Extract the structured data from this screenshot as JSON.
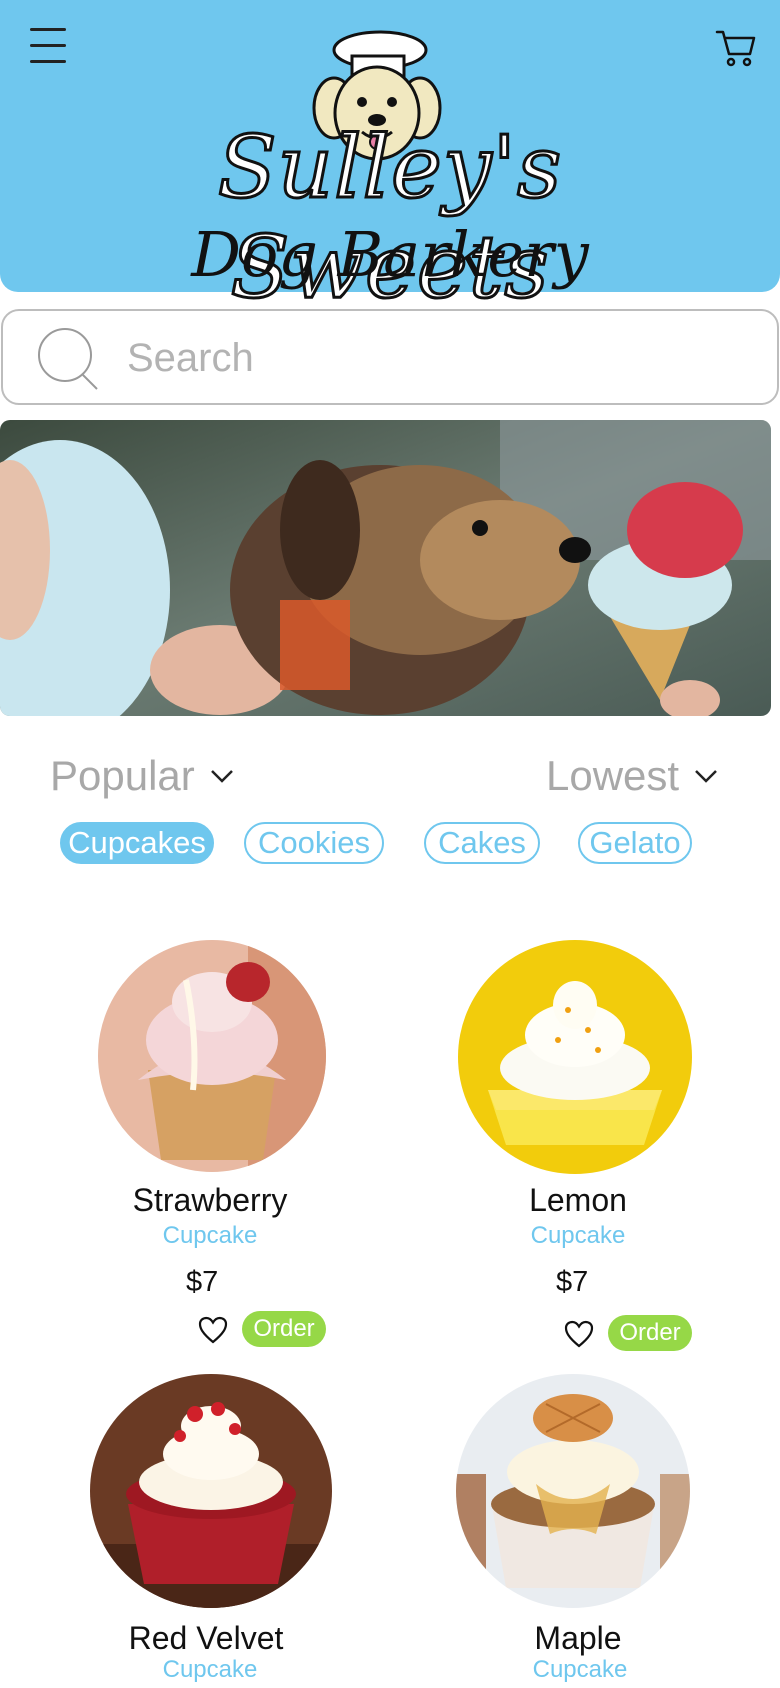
{
  "header": {
    "menu_icon": "hamburger-menu-icon",
    "cart_icon": "shopping-cart-icon",
    "logo_title": "Sulley's Sweets",
    "logo_subtitle": "Dog Barkery",
    "background_color": "#6fc7ee"
  },
  "search": {
    "placeholder": "Search",
    "icon": "search-icon"
  },
  "hero": {
    "description": "dog-licking-ice-cream-photo"
  },
  "filters": {
    "sort": "Popular",
    "price_order": "Lowest",
    "chevron_icon": "chevron-down-icon"
  },
  "categories": [
    {
      "label": "Cupcakes",
      "active": true
    },
    {
      "label": "Cookies",
      "active": false
    },
    {
      "label": "Cakes",
      "active": false
    },
    {
      "label": "Gelato",
      "active": false
    }
  ],
  "products": [
    {
      "name": "Strawberry",
      "type": "Cupcake",
      "price": "$7",
      "order_label": "Order"
    },
    {
      "name": "Lemon",
      "type": "Cupcake",
      "price": "$7",
      "order_label": "Order"
    },
    {
      "name": "Red Velvet",
      "type": "Cupcake"
    },
    {
      "name": "Maple",
      "type": "Cupcake"
    }
  ],
  "colors": {
    "accent": "#6fc7ee",
    "order_button": "#96d847",
    "muted_text": "#a8a8a8"
  }
}
